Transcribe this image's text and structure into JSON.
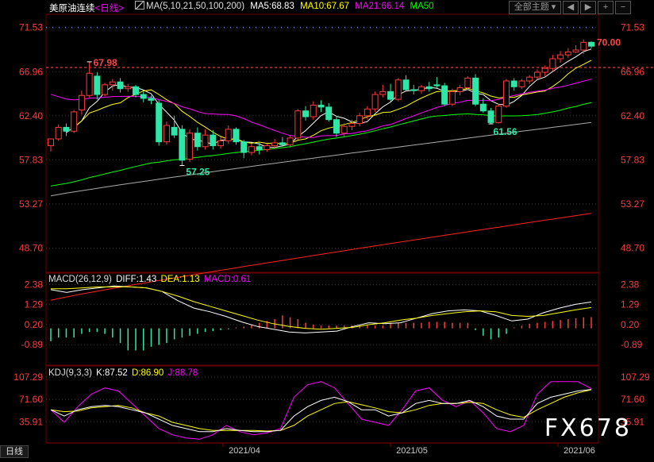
{
  "header": {
    "title": "美原油连续",
    "period": "<日线>",
    "ma_title": "MA(5,10,21,50,100,200)",
    "ma5": "MA5:68.83",
    "ma10": "MA10:67.67",
    "ma21": "MA21:66.14",
    "ma50": "MA50",
    "theme_select": "全部主题",
    "colors": {
      "ma5": "#ffffff",
      "ma10": "#ffff00",
      "ma21": "#ff00ff",
      "ma50": "#00ff00",
      "ma100": "#aaaaaa",
      "ma200": "#ff2020"
    }
  },
  "price_panel": {
    "y_ticks": [
      "71.53",
      "66.96",
      "62.40",
      "57.83",
      "53.27",
      "48.70"
    ],
    "annotations": {
      "high": "67.98",
      "low1": "57.25",
      "low2": "61.56",
      "last": "70.00"
    }
  },
  "macd_panel": {
    "title": "MACD(26,12,9)",
    "diff": "DIFF:1.43",
    "dea": "DEA:1.13",
    "macd": "MACD:0.61",
    "y_ticks": [
      "2.38",
      "1.29",
      "0.20",
      "-0.89"
    ]
  },
  "kdj_panel": {
    "title": "KDJ(9,3,3)",
    "k": "K:87.52",
    "d": "D:86.90",
    "j": "J:88.78",
    "y_ticks": [
      "107.29",
      "71.60",
      "35.91"
    ]
  },
  "x_axis": {
    "labels": [
      "2021/04",
      "2021/05",
      "2021/06"
    ]
  },
  "bottom_tab": "日线",
  "watermark": "FX678",
  "chart_data": {
    "type": "candlestick",
    "candles": [
      [
        59.3,
        60.0,
        58.7,
        60.0
      ],
      [
        60.0,
        61.5,
        59.8,
        61.2
      ],
      [
        61.2,
        61.6,
        60.3,
        60.8
      ],
      [
        60.8,
        63.0,
        60.6,
        62.8
      ],
      [
        63.0,
        65.0,
        62.5,
        64.5
      ],
      [
        64.5,
        67.98,
        64.3,
        66.8
      ],
      [
        66.5,
        66.9,
        64.1,
        64.6
      ],
      [
        64.6,
        65.8,
        64.4,
        65.6
      ],
      [
        65.6,
        66.2,
        65.0,
        65.9
      ],
      [
        65.9,
        66.3,
        64.8,
        65.2
      ],
      [
        65.2,
        65.7,
        64.9,
        65.4
      ],
      [
        65.4,
        65.6,
        64.3,
        64.6
      ],
      [
        64.6,
        64.9,
        63.8,
        64.2
      ],
      [
        64.2,
        64.5,
        63.6,
        64.0
      ],
      [
        63.7,
        64.0,
        59.3,
        59.7
      ],
      [
        59.7,
        61.8,
        59.4,
        61.4
      ],
      [
        61.2,
        62.4,
        60.1,
        60.4
      ],
      [
        61.0,
        61.4,
        57.25,
        57.8
      ],
      [
        57.9,
        61.0,
        57.6,
        60.6
      ],
      [
        60.6,
        61.2,
        58.8,
        59.2
      ],
      [
        59.2,
        61.0,
        58.9,
        60.4
      ],
      [
        60.4,
        60.9,
        58.9,
        59.3
      ],
      [
        59.3,
        60.2,
        59.0,
        59.8
      ],
      [
        59.8,
        61.4,
        59.5,
        61.0
      ],
      [
        61.0,
        61.2,
        59.4,
        59.7
      ],
      [
        59.7,
        59.9,
        58.0,
        58.6
      ],
      [
        58.6,
        59.5,
        58.3,
        59.2
      ],
      [
        59.2,
        59.6,
        58.4,
        58.9
      ],
      [
        58.9,
        59.5,
        58.7,
        59.3
      ],
      [
        59.3,
        60.0,
        59.0,
        59.6
      ],
      [
        59.6,
        60.2,
        59.2,
        59.4
      ],
      [
        59.4,
        60.4,
        59.1,
        60.1
      ],
      [
        60.1,
        63.1,
        59.9,
        62.9
      ],
      [
        62.9,
        63.4,
        61.9,
        62.3
      ],
      [
        62.3,
        63.9,
        62.0,
        63.5
      ],
      [
        63.5,
        64.0,
        62.8,
        63.3
      ],
      [
        63.3,
        63.7,
        61.8,
        62.0
      ],
      [
        62.0,
        62.4,
        60.2,
        60.6
      ],
      [
        60.6,
        61.6,
        60.2,
        61.3
      ],
      [
        61.3,
        62.0,
        60.9,
        61.6
      ],
      [
        61.6,
        62.7,
        61.3,
        62.4
      ],
      [
        62.4,
        63.4,
        62.0,
        63.1
      ],
      [
        63.1,
        64.9,
        62.8,
        64.6
      ],
      [
        64.6,
        65.6,
        64.3,
        64.9
      ],
      [
        64.9,
        65.7,
        63.9,
        64.1
      ],
      [
        64.1,
        66.3,
        63.9,
        66.1
      ],
      [
        66.1,
        66.6,
        64.9,
        65.1
      ],
      [
        65.1,
        65.6,
        64.6,
        65.0
      ],
      [
        65.0,
        65.6,
        64.7,
        65.4
      ],
      [
        65.4,
        65.9,
        64.9,
        65.2
      ],
      [
        65.6,
        66.4,
        65.3,
        65.5
      ],
      [
        65.5,
        65.8,
        63.4,
        63.6
      ],
      [
        63.6,
        65.2,
        63.4,
        64.9
      ],
      [
        64.9,
        65.6,
        64.5,
        65.3
      ],
      [
        65.3,
        66.5,
        65.1,
        66.3
      ],
      [
        66.3,
        66.7,
        63.4,
        63.6
      ],
      [
        63.6,
        64.2,
        62.7,
        62.9
      ],
      [
        62.9,
        63.2,
        61.56,
        61.7
      ],
      [
        61.7,
        63.6,
        61.6,
        63.4
      ],
      [
        63.4,
        66.2,
        63.2,
        66.0
      ],
      [
        66.0,
        66.3,
        65.0,
        65.4
      ],
      [
        65.4,
        66.2,
        65.2,
        66.0
      ],
      [
        66.0,
        66.6,
        65.7,
        66.4
      ],
      [
        66.4,
        67.2,
        66.2,
        66.9
      ],
      [
        66.9,
        67.6,
        66.5,
        67.3
      ],
      [
        67.3,
        68.7,
        67.0,
        68.3
      ],
      [
        68.3,
        69.1,
        67.9,
        68.7
      ],
      [
        68.7,
        69.4,
        68.4,
        69.0
      ],
      [
        69.0,
        69.7,
        68.9,
        69.2
      ],
      [
        69.2,
        70.3,
        68.8,
        70.0
      ],
      [
        70.0,
        70.1,
        69.4,
        69.6
      ]
    ],
    "ma": {
      "ma100": {
        "start": 54.1,
        "end": 61.7
      },
      "ma200": {
        "start": 43.3,
        "end": 52.3
      }
    },
    "macd": {
      "dif": [
        2.1,
        1.95,
        2.1,
        2.2,
        2.3,
        2.25,
        2.2,
        2.0,
        1.5,
        1.1,
        0.9,
        0.65,
        0.35,
        0.1,
        -0.05,
        -0.2,
        -0.25,
        -0.2,
        -0.15,
        0.1,
        0.3,
        0.25,
        0.3,
        0.55,
        0.8,
        0.95,
        1.0,
        0.95,
        0.7,
        0.4,
        0.5,
        0.85,
        1.1,
        1.3,
        1.43
      ],
      "dea": [
        2.15,
        2.15,
        2.2,
        2.25,
        2.25,
        2.25,
        2.2,
        2.0,
        1.75,
        1.45,
        1.2,
        0.95,
        0.7,
        0.45,
        0.25,
        0.1,
        0.0,
        -0.05,
        0.0,
        0.05,
        0.2,
        0.3,
        0.45,
        0.55,
        0.7,
        0.8,
        0.9,
        0.95,
        0.9,
        0.7,
        0.65,
        0.7,
        0.85,
        1.0,
        1.13
      ],
      "hist": [
        -0.7,
        -0.5,
        -0.5,
        -0.5,
        -0.3,
        -0.2,
        -0.2,
        -0.3,
        -0.5,
        -0.8,
        -1.2,
        -1.2,
        -1.2,
        -1.0,
        -0.9,
        -0.8,
        -0.6,
        -0.5,
        -0.4,
        -0.3,
        -0.2,
        -0.15,
        -0.1,
        -0.05,
        0.05,
        0.1,
        0.2,
        0.3,
        0.4,
        0.5,
        0.7,
        0.6,
        0.5,
        0.3,
        0.2,
        0.15,
        0.15,
        0.15,
        0.15,
        0.15,
        0.15,
        0.15,
        0.15,
        0.15,
        0.3,
        0.3,
        0.3,
        0.3,
        0.3,
        0.35,
        0.35,
        0.35,
        0.3,
        0.3,
        0.3,
        -0.1,
        -0.4,
        -0.6,
        -0.5,
        -0.3,
        0.05,
        0.15,
        0.25,
        0.3,
        0.35,
        0.4,
        0.45,
        0.5,
        0.55,
        0.6,
        0.61
      ]
    },
    "kdj": {
      "k": [
        55,
        45,
        55,
        60,
        62,
        60,
        55,
        50,
        40,
        30,
        25,
        20,
        20,
        25,
        22,
        20,
        20,
        22,
        45,
        60,
        70,
        75,
        68,
        55,
        55,
        45,
        50,
        65,
        70,
        65,
        65,
        70,
        60,
        45,
        40,
        40,
        65,
        75,
        80,
        85,
        87.52
      ],
      "d": [
        55,
        52,
        53,
        58,
        60,
        62,
        58,
        50,
        45,
        35,
        30,
        25,
        22,
        22,
        22,
        22,
        21,
        22,
        30,
        45,
        55,
        65,
        68,
        63,
        58,
        52,
        50,
        55,
        62,
        65,
        65,
        67,
        65,
        55,
        47,
        43,
        55,
        65,
        75,
        82,
        86.9
      ],
      "j": [
        55,
        35,
        60,
        80,
        90,
        85,
        65,
        45,
        25,
        15,
        10,
        8,
        15,
        30,
        20,
        15,
        18,
        25,
        75,
        95,
        100,
        90,
        65,
        40,
        35,
        30,
        55,
        85,
        90,
        70,
        60,
        70,
        50,
        25,
        20,
        30,
        80,
        100,
        100,
        100,
        88.78
      ]
    }
  }
}
